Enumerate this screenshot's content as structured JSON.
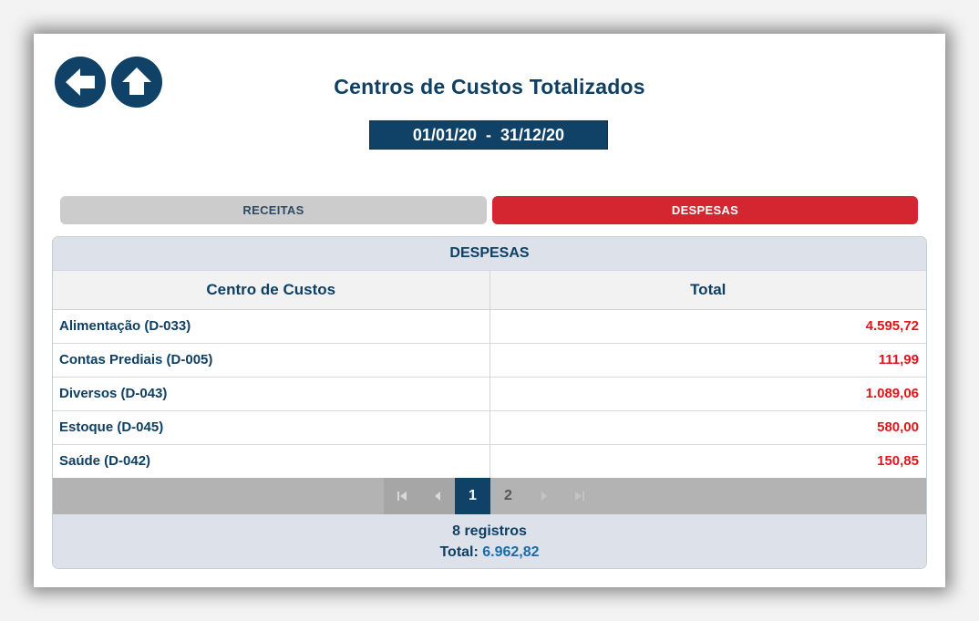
{
  "header": {
    "title": "Centros de Custos Totalizados",
    "date_range": "01/01/20  -  31/12/20"
  },
  "nav": {
    "back_icon": "arrow-left-icon",
    "home_icon": "arrow-up-icon"
  },
  "tabs": [
    {
      "label": "RECEITAS",
      "active": false
    },
    {
      "label": "DESPESAS",
      "active": true
    }
  ],
  "panel": {
    "title": "DESPESAS",
    "columns": [
      "Centro de Custos",
      "Total"
    ],
    "rows": [
      {
        "name": "Alimentação (D-033)",
        "total": "4.595,72"
      },
      {
        "name": "Contas Prediais (D-005)",
        "total": "111,99"
      },
      {
        "name": "Diversos (D-043)",
        "total": "1.089,06"
      },
      {
        "name": "Estoque (D-045)",
        "total": "580,00"
      },
      {
        "name": "Saúde (D-042)",
        "total": "150,85"
      }
    ],
    "pagination": {
      "pages": [
        "1",
        "2"
      ],
      "current": "1"
    },
    "footer": {
      "records": "8 registros",
      "total_label": "Total:",
      "total_value": "6.962,82"
    }
  },
  "colors": {
    "primary": "#0f4266",
    "expense_red": "#d42630",
    "value_red": "#e0151b"
  }
}
